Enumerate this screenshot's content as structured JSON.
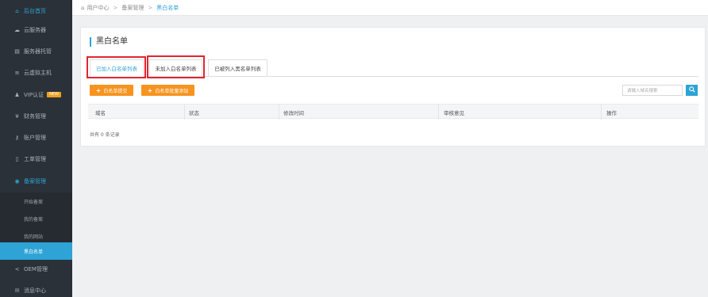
{
  "sidebar": {
    "items": [
      {
        "label": "后台首页",
        "icon": "home-icon"
      },
      {
        "label": "云服务器",
        "icon": "cloud-icon"
      },
      {
        "label": "服务器托管",
        "icon": "server-icon"
      },
      {
        "label": "云虚拟主机",
        "icon": "list-icon"
      },
      {
        "label": "VIP认证",
        "icon": "user-icon",
        "badge": "NEW"
      },
      {
        "label": "财务管理",
        "icon": "yen-icon"
      },
      {
        "label": "账户管理",
        "icon": "key-icon"
      },
      {
        "label": "工单管理",
        "icon": "ticket-icon"
      },
      {
        "label": "备案管理",
        "icon": "record-icon"
      },
      {
        "label": "OEM管理",
        "icon": "share-icon"
      },
      {
        "label": "消息中心",
        "icon": "message-icon"
      }
    ],
    "sub_items": [
      {
        "label": "开始备案"
      },
      {
        "label": "我的备案"
      },
      {
        "label": "我的网站"
      },
      {
        "label": "黑白名单"
      }
    ]
  },
  "breadcrumb": {
    "home": "用户中心",
    "level2": "备案管理",
    "current": "黑白名单",
    "separator": ">"
  },
  "main": {
    "title": "黑白名单",
    "tabs": [
      {
        "label": "已加入白名单列表"
      },
      {
        "label": "未加入白名单列表"
      },
      {
        "label": "已被列入黑名单列表"
      }
    ],
    "buttons": {
      "add_whitelist": "白名单提交",
      "batch_add": "白名单批量添加"
    },
    "search": {
      "placeholder": "请输入域名搜索"
    },
    "table": {
      "columns": [
        "域名",
        "状态",
        "修改时间",
        "审核意见",
        "操作"
      ]
    },
    "record_count": "共有 0 条记录"
  },
  "colors": {
    "sidebar_bg": "#2b3138",
    "accent": "#2da3d6",
    "orange": "#f7931e",
    "highlight": "#e0262e"
  }
}
